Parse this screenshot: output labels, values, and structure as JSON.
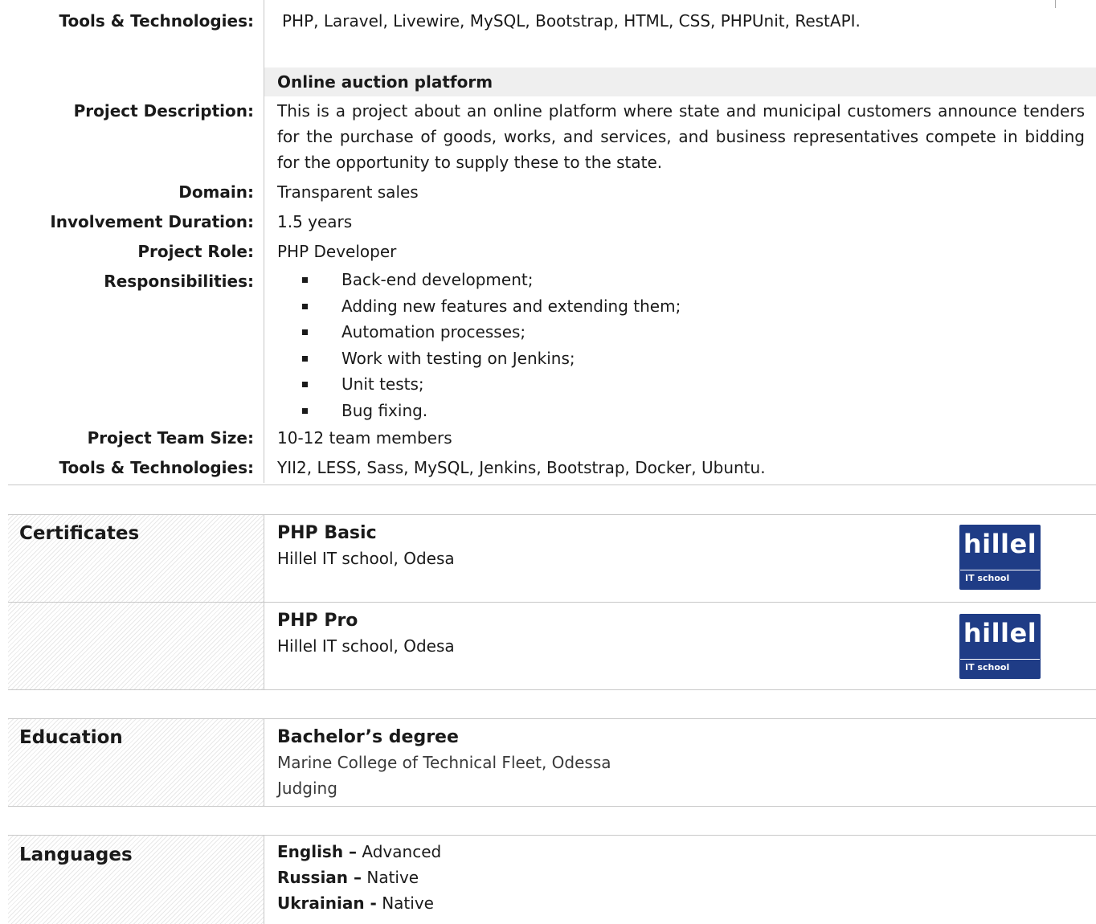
{
  "project_top": {
    "tools_label": "Tools & Technologies:",
    "tools_value": "PHP, Laravel, Livewire, MySQL, Bootstrap, HTML, CSS, PHPUnit, RestAPI."
  },
  "project": {
    "title": "Online auction platform",
    "description_label": "Project Description:",
    "description": "This is a project about an online platform where state and municipal customers announce tenders for the purchase of goods, works, and services, and business representatives compete in bidding for the opportunity to supply these to the state.",
    "domain_label": "Domain:",
    "domain": "Transparent sales",
    "duration_label": "Involvement Duration:",
    "duration": "1.5 years",
    "role_label": "Project Role:",
    "role": "PHP Developer",
    "responsibilities_label": "Responsibilities:",
    "responsibilities": [
      "Back-end development;",
      "Adding new features and extending them;",
      "Automation processes;",
      "Work with testing on Jenkins;",
      "Unit tests;",
      "Bug fixing."
    ],
    "team_label": "Project Team Size:",
    "team": "10-12 team members",
    "tools_label": "Tools & Technologies:",
    "tools": "YII2, LESS, Sass, MySQL, Jenkins, Bootstrap, Docker, Ubuntu."
  },
  "certificates": {
    "heading": "Certificates",
    "items": [
      {
        "title": "PHP Basic",
        "issuer": "Hillel IT school, Odesa",
        "logo_word": "hillel",
        "logo_sub": "IT school"
      },
      {
        "title": "PHP Pro",
        "issuer": "Hillel IT school, Odesa",
        "logo_word": "hillel",
        "logo_sub": "IT school"
      }
    ],
    "logo_color": "#1f3c86"
  },
  "education": {
    "heading": "Education",
    "degree": "Bachelor’s degree",
    "institution": "Marine College of Technical Fleet, Odessa",
    "field": "Judging"
  },
  "languages": {
    "heading": "Languages",
    "items": [
      {
        "name": "English –",
        "level": "Advanced"
      },
      {
        "name": "Russian –",
        "level": "Native"
      },
      {
        "name": "Ukrainian -",
        "level": "Native"
      }
    ]
  }
}
